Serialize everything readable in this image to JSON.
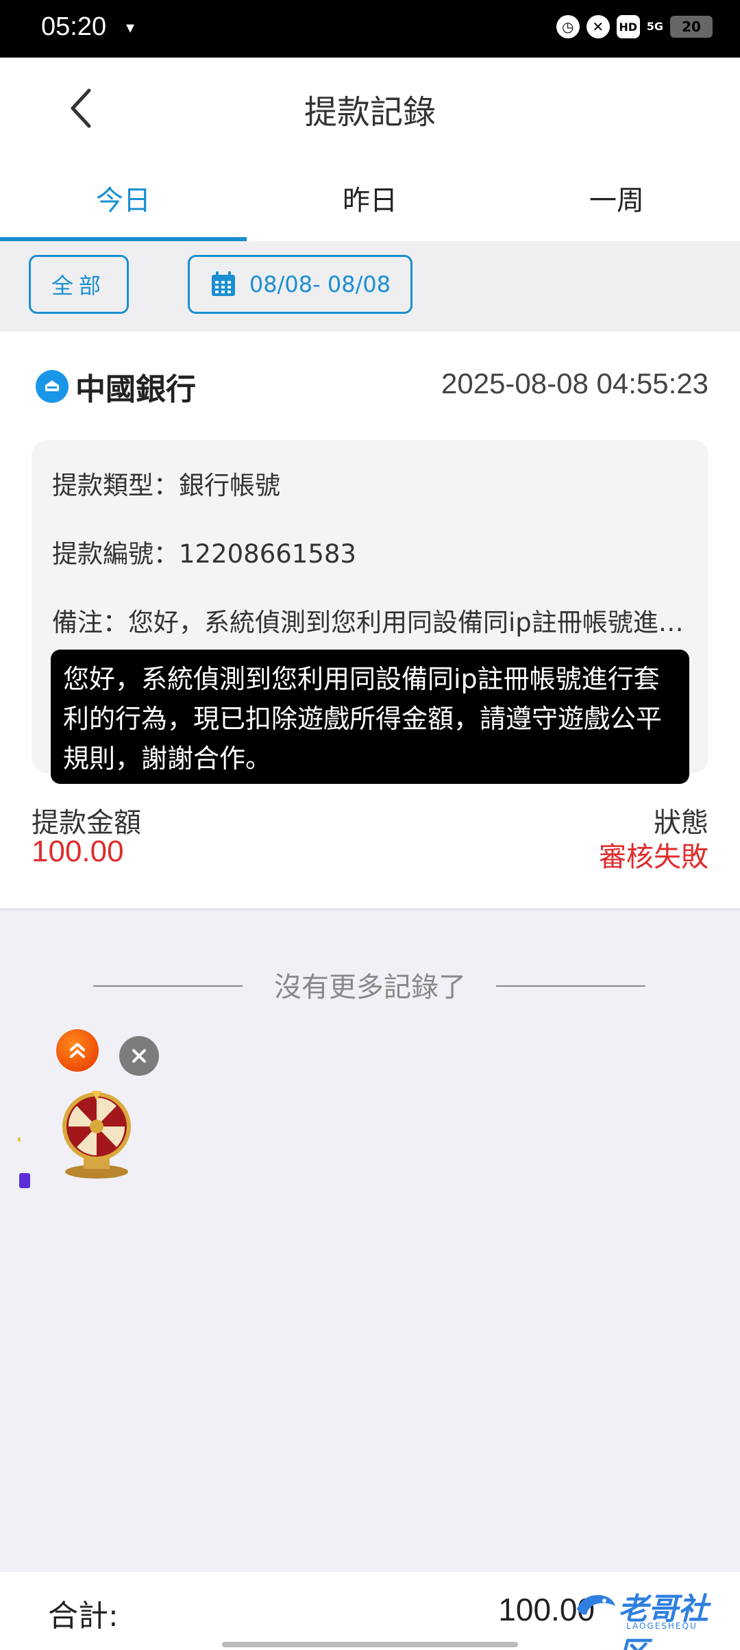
{
  "status_bar": {
    "time": "05:20",
    "battery": "20",
    "network": "5G"
  },
  "header": {
    "title": "提款記錄"
  },
  "tabs": [
    {
      "label": "今日",
      "active": true
    },
    {
      "label": "昨日",
      "active": false
    },
    {
      "label": "一周",
      "active": false
    }
  ],
  "filters": {
    "all_label": "全部",
    "date_range": "08/08- 08/08"
  },
  "record": {
    "bank_name": "中國銀行",
    "time": "2025-08-08 04:55:23",
    "type_label": "提款類型：",
    "type_value": "銀行帳號",
    "id_label": "提款編號：",
    "id_value": "12208661583",
    "note_label": "備注：",
    "note_value": "您好，系統偵測到您利用同設備同ip註冊帳號進行套利的行為，現已扣除遊戲所得金額，請遵守遊戲公平規則，謝謝合作。",
    "tooltip": "您好，系統偵測到您利用同設備同ip註冊帳號進行套利的行為，現已扣除遊戲所得金額，請遵守遊戲公平規則，謝謝合作。",
    "amount_label": "提款金額",
    "amount_value": "100.00",
    "status_label": "狀態",
    "status_value": "審核失敗"
  },
  "no_more": "沒有更多記錄了",
  "footer": {
    "total_label": "合計:",
    "total_value": "100.00",
    "watermark": "老哥社区",
    "watermark_sub": "LAOGESHEQU"
  },
  "colors": {
    "accent": "#1a8fd1",
    "error": "#e02c2c"
  }
}
